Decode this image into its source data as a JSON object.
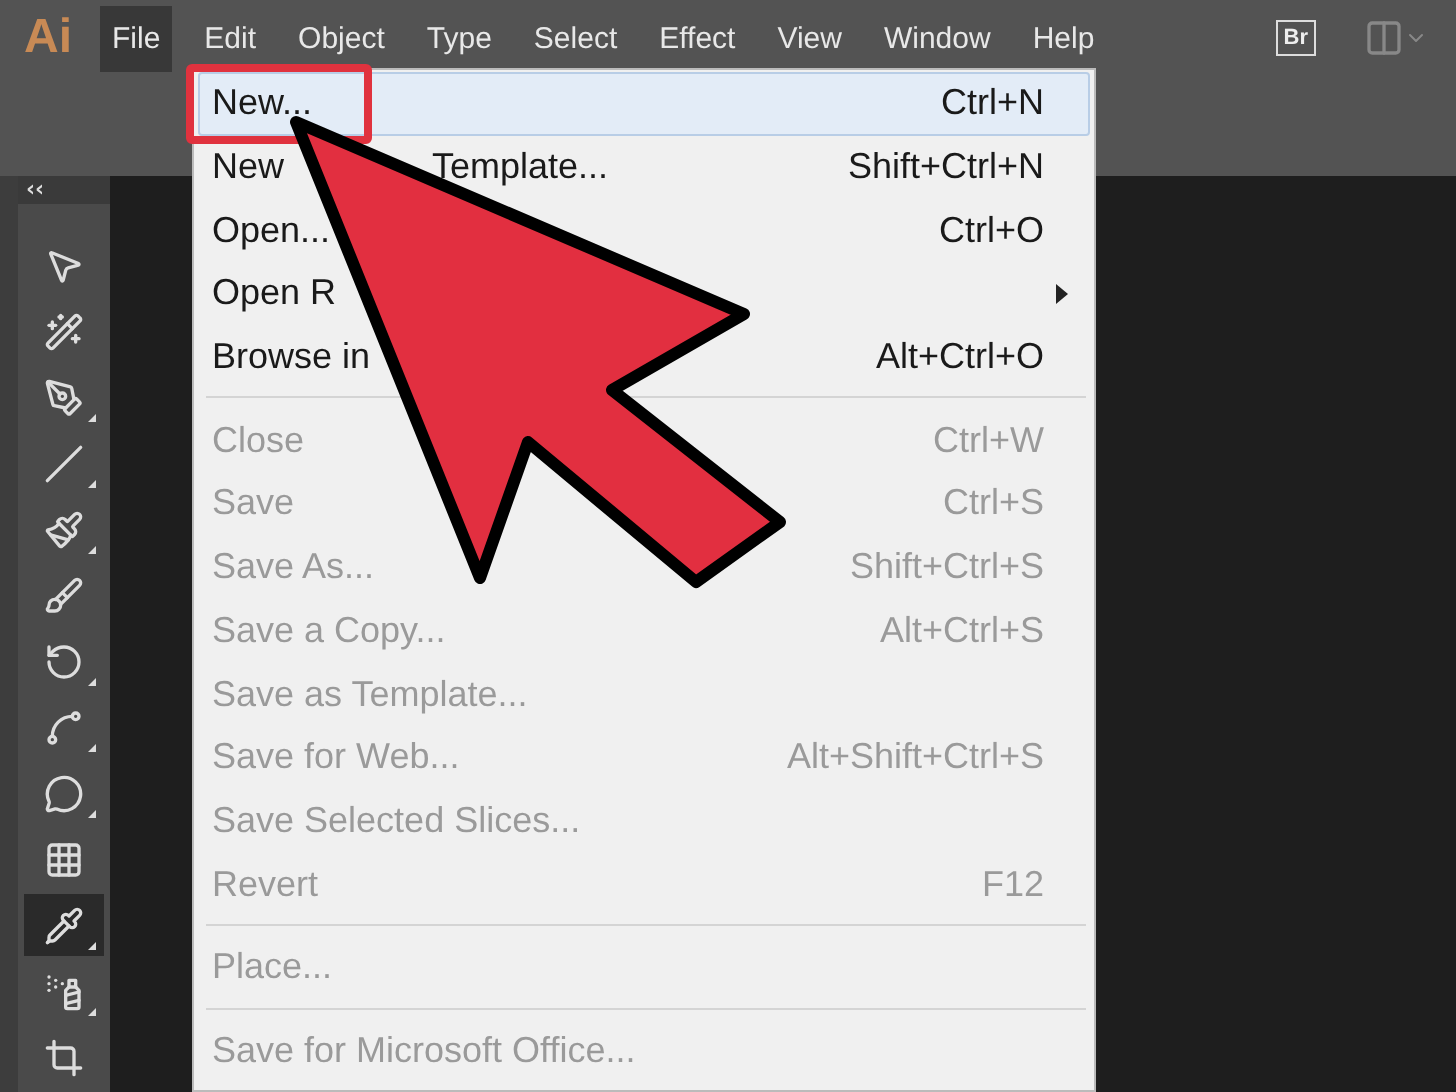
{
  "app_logo": "Ai",
  "menubar": [
    {
      "label": "File",
      "selected": true
    },
    {
      "label": "Edit",
      "selected": false
    },
    {
      "label": "Object",
      "selected": false
    },
    {
      "label": "Type",
      "selected": false
    },
    {
      "label": "Select",
      "selected": false
    },
    {
      "label": "Effect",
      "selected": false
    },
    {
      "label": "View",
      "selected": false
    },
    {
      "label": "Window",
      "selected": false
    },
    {
      "label": "Help",
      "selected": false
    }
  ],
  "bridge_button": "Br",
  "tool_panel": {
    "collapse": "‹‹",
    "tools": [
      {
        "selected": false,
        "flyout": false
      },
      {
        "selected": false,
        "flyout": false
      },
      {
        "selected": false,
        "flyout": true
      },
      {
        "selected": false,
        "flyout": true
      },
      {
        "selected": false,
        "flyout": true
      },
      {
        "selected": false,
        "flyout": false
      },
      {
        "selected": false,
        "flyout": true
      },
      {
        "selected": false,
        "flyout": true
      },
      {
        "selected": false,
        "flyout": true
      },
      {
        "selected": false,
        "flyout": false
      },
      {
        "selected": true,
        "flyout": true
      },
      {
        "selected": false,
        "flyout": true
      },
      {
        "selected": false,
        "flyout": false
      }
    ]
  },
  "file_menu": [
    {
      "kind": "item",
      "label_parts": [
        "New..."
      ],
      "shortcut": "Ctrl+N",
      "selected": true,
      "disabled": false,
      "submenu": false
    },
    {
      "kind": "item",
      "label_parts": [
        "New",
        "Template..."
      ],
      "shortcut": "Shift+Ctrl+N",
      "selected": false,
      "disabled": false,
      "submenu": false
    },
    {
      "kind": "item",
      "label_parts": [
        "Open..."
      ],
      "shortcut": "Ctrl+O",
      "selected": false,
      "disabled": false,
      "submenu": false
    },
    {
      "kind": "item",
      "label_parts": [
        "Open R"
      ],
      "selected": false,
      "disabled": false,
      "submenu": true
    },
    {
      "kind": "item",
      "label_parts": [
        "Browse in"
      ],
      "shortcut": "Alt+Ctrl+O",
      "selected": false,
      "disabled": false,
      "submenu": false
    },
    {
      "kind": "separator"
    },
    {
      "kind": "item",
      "label_parts": [
        "Close"
      ],
      "shortcut": "Ctrl+W",
      "selected": false,
      "disabled": true,
      "submenu": false
    },
    {
      "kind": "item",
      "label_parts": [
        "Save"
      ],
      "shortcut": "Ctrl+S",
      "selected": false,
      "disabled": true,
      "submenu": false
    },
    {
      "kind": "item",
      "label_parts": [
        "Save As..."
      ],
      "shortcut": "Shift+Ctrl+S",
      "selected": false,
      "disabled": true,
      "submenu": false
    },
    {
      "kind": "item",
      "label_parts": [
        "Save a Copy..."
      ],
      "shortcut": "Alt+Ctrl+S",
      "selected": false,
      "disabled": true,
      "submenu": false
    },
    {
      "kind": "item",
      "label_parts": [
        "Save as Template..."
      ],
      "selected": false,
      "disabled": true,
      "submenu": false
    },
    {
      "kind": "item",
      "label_parts": [
        "Save for Web..."
      ],
      "shortcut": "Alt+Shift+Ctrl+S",
      "selected": false,
      "disabled": true,
      "submenu": false
    },
    {
      "kind": "item",
      "label_parts": [
        "Save Selected Slices..."
      ],
      "selected": false,
      "disabled": true,
      "submenu": false
    },
    {
      "kind": "item",
      "label_parts": [
        "Revert"
      ],
      "shortcut": "F12",
      "selected": false,
      "disabled": true,
      "submenu": false
    },
    {
      "kind": "separator"
    },
    {
      "kind": "item",
      "label_parts": [
        "Place..."
      ],
      "selected": false,
      "disabled": true,
      "submenu": false
    },
    {
      "kind": "separator"
    },
    {
      "kind": "item",
      "label_parts": [
        "Save for Microsoft Office..."
      ],
      "selected": false,
      "disabled": true,
      "submenu": false
    }
  ],
  "annotation": {
    "kind": "arrow_with_frame"
  }
}
